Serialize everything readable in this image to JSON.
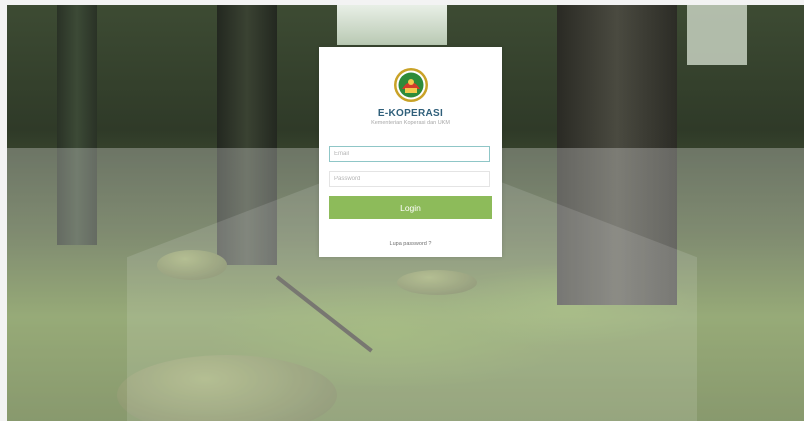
{
  "app": {
    "title": "E-KOPERASI",
    "subtitle": "Kementerian Koperasi dan UKM"
  },
  "login": {
    "email_placeholder": "Email",
    "email_value": "",
    "password_placeholder": "Password",
    "password_value": "",
    "submit_label": "Login",
    "forgot_label": "Lupa password ?"
  },
  "colors": {
    "accent": "#8dbb5a",
    "title": "#2f5f7a",
    "focus_border": "#8fc6c7"
  },
  "icons": {
    "logo": "kementerian-koperasi-logo"
  }
}
